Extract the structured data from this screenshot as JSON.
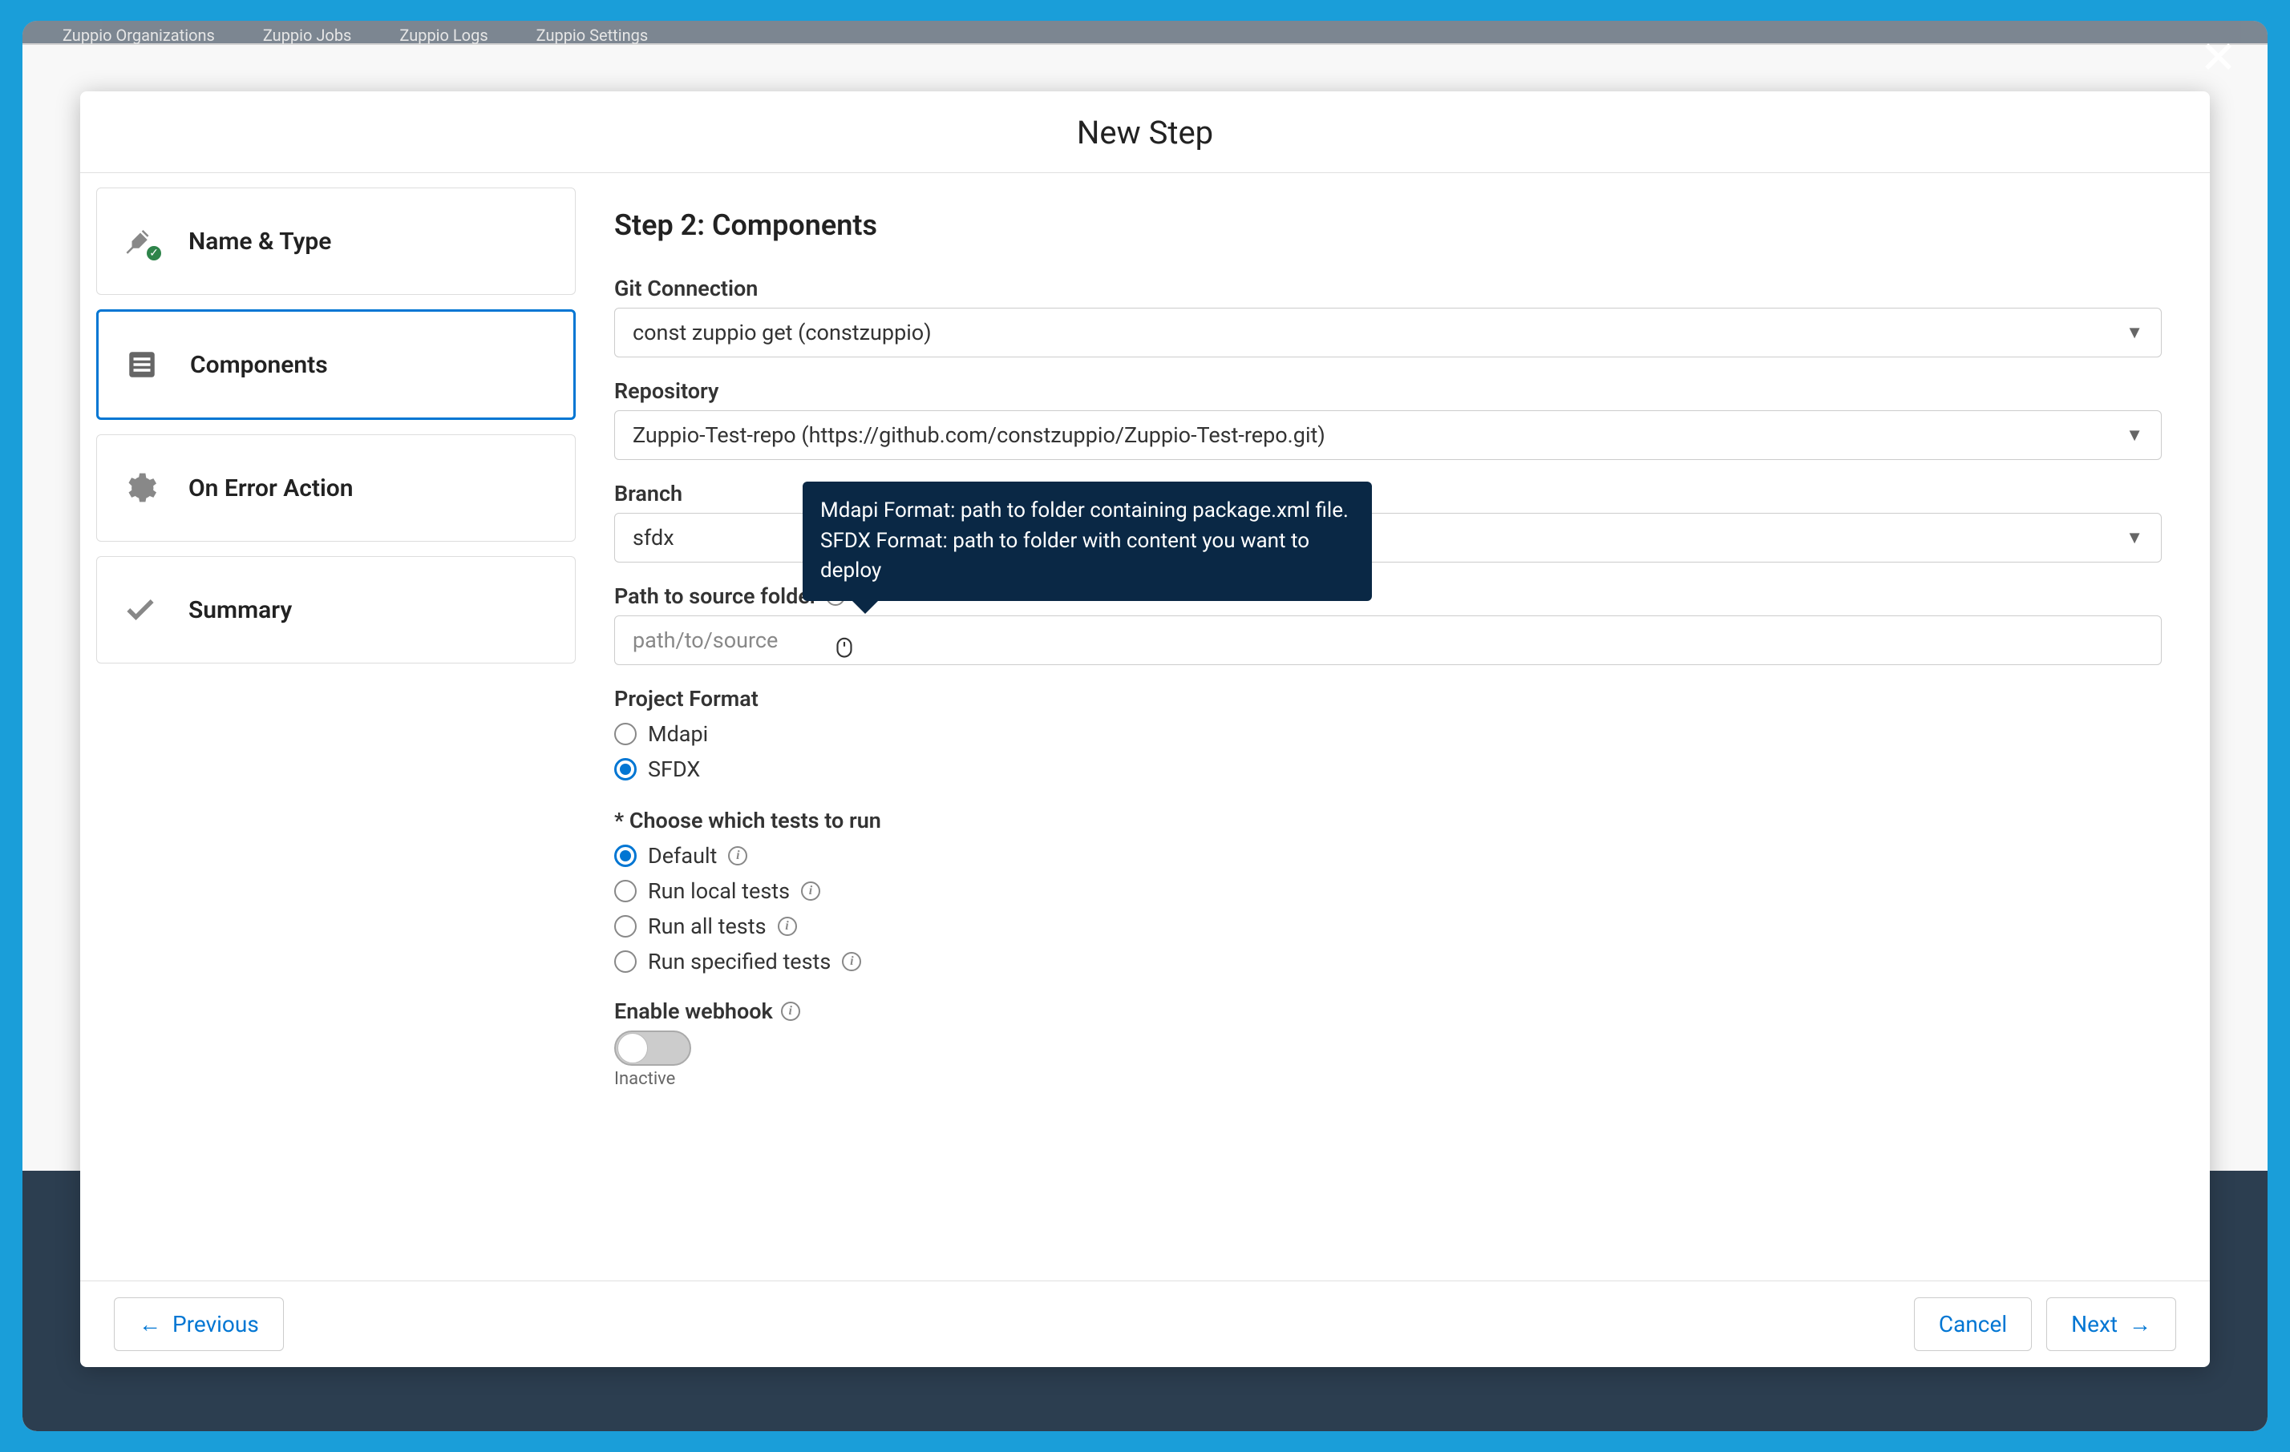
{
  "bg": {
    "tabs": [
      "Zuppio Organizations",
      "Zuppio Jobs",
      "Zuppio Logs",
      "Zuppio Settings"
    ]
  },
  "modal": {
    "title": "New Step",
    "close": "✕"
  },
  "sidebar": {
    "items": [
      {
        "label": "Name & Type",
        "icon": "pin-icon",
        "completed": true
      },
      {
        "label": "Components",
        "icon": "components-icon",
        "active": true
      },
      {
        "label": "On Error Action",
        "icon": "gear-icon"
      },
      {
        "label": "Summary",
        "icon": "check-icon"
      }
    ]
  },
  "form": {
    "heading": "Step 2: Components",
    "gitConnection": {
      "label": "Git Connection",
      "value": "const zuppio get (constzuppio)"
    },
    "repository": {
      "label": "Repository",
      "value": "Zuppio-Test-repo (https://github.com/constzuppio/Zuppio-Test-repo.git)"
    },
    "branch": {
      "label": "Branch",
      "value": "sfdx"
    },
    "path": {
      "label": "Path to source folder",
      "placeholder": "path/to/source"
    },
    "tooltip": "Mdapi Format: path to folder containing package.xml file. SFDX Format: path to folder with content you want to deploy",
    "projectFormat": {
      "label": "Project Format",
      "options": [
        "Mdapi",
        "SFDX"
      ],
      "selected": "SFDX"
    },
    "tests": {
      "label": "* Choose which tests to run",
      "options": [
        "Default",
        "Run local tests",
        "Run all tests",
        "Run specified tests"
      ],
      "selected": "Default"
    },
    "webhook": {
      "label": "Enable webhook",
      "state": "Inactive"
    }
  },
  "footer": {
    "previous": "Previous",
    "cancel": "Cancel",
    "next": "Next"
  }
}
